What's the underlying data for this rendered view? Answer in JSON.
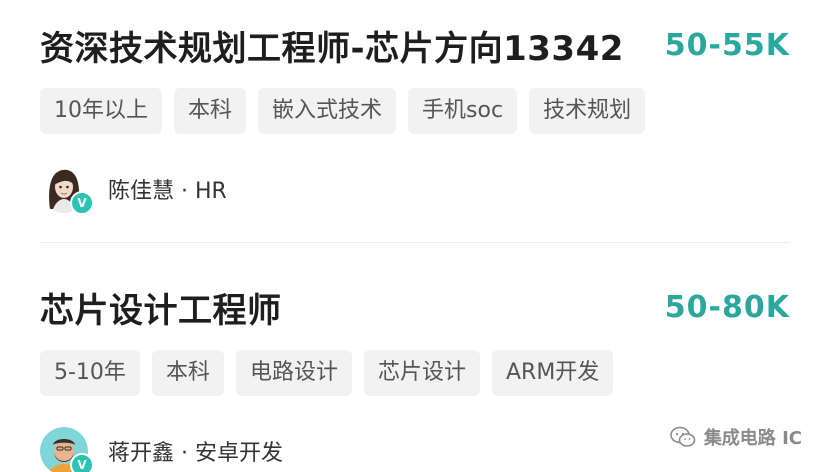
{
  "jobs": [
    {
      "title": "资深技术规划工程师-芯片方向13342",
      "salary": "50-55K",
      "tags": [
        "10年以上",
        "本科",
        "嵌入式技术",
        "手机soc",
        "技术规划"
      ],
      "recruiter": "陈佳慧 · HR",
      "badge": "V"
    },
    {
      "title": "芯片设计工程师",
      "salary": "50-80K",
      "tags": [
        "5-10年",
        "本科",
        "电路设计",
        "芯片设计",
        "ARM开发"
      ],
      "recruiter": "蒋开鑫 · 安卓开发",
      "badge": "V"
    }
  ],
  "watermark": {
    "text": "集成电路 IC",
    "icon": "wechat-icon"
  },
  "colors": {
    "salary": "#2aa89e",
    "badge": "#2ac3b4",
    "tag_bg": "#f2f2f2"
  }
}
